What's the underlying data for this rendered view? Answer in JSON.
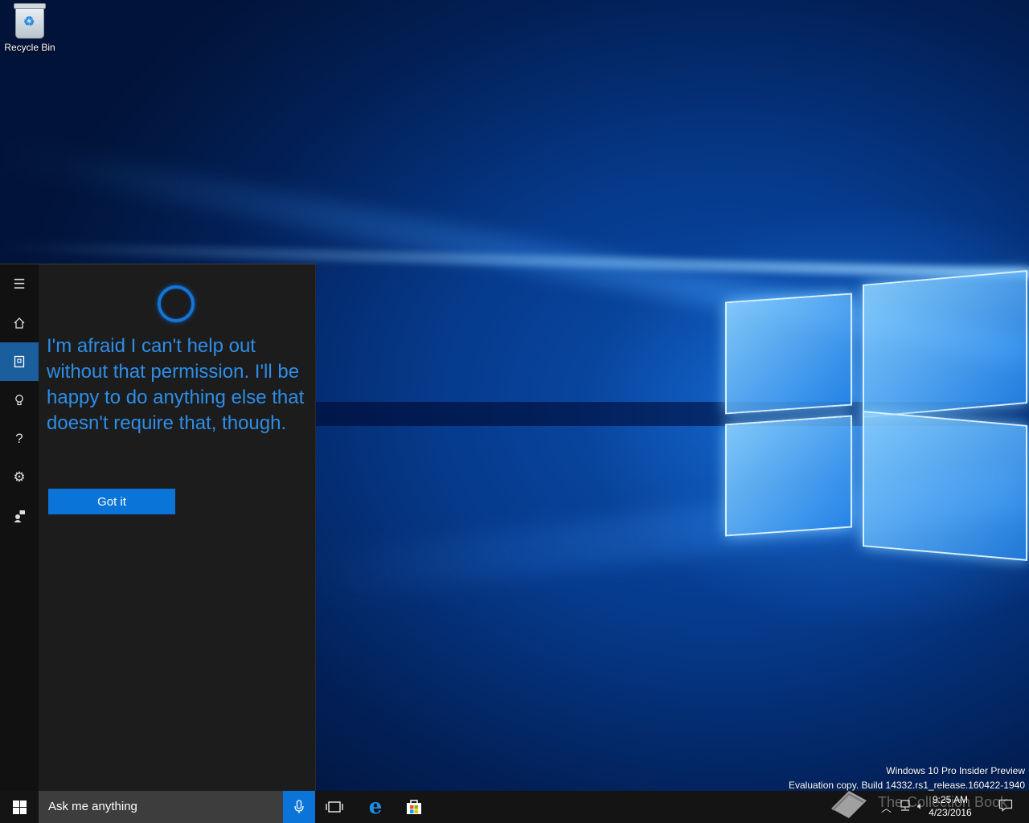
{
  "desktop": {
    "icons": [
      {
        "label": "Recycle Bin"
      }
    ],
    "watermark": {
      "line1": "Windows 10 Pro Insider Preview",
      "line2": "Evaluation copy. Build 14332.rs1_release.160422-1940"
    }
  },
  "cortana": {
    "rail": [
      {
        "name": "menu",
        "icon": "hamburger-icon"
      },
      {
        "name": "home",
        "icon": "home-icon"
      },
      {
        "name": "notebook",
        "icon": "notebook-icon",
        "active": true
      },
      {
        "name": "tips",
        "icon": "lightbulb-icon"
      },
      {
        "name": "help",
        "icon": "help-icon"
      },
      {
        "name": "settings",
        "icon": "gear-icon"
      },
      {
        "name": "feedback",
        "icon": "feedback-icon"
      }
    ],
    "message": "I'm afraid I can't help out without that permission. I'll be happy to do anything else that doesn't require that, though.",
    "button_label": "Got it",
    "accent": "#0b74d8"
  },
  "taskbar": {
    "search_placeholder": "Ask me anything",
    "pinned": [
      "task-view-icon",
      "edge-icon",
      "store-icon"
    ],
    "clock": {
      "time": "9:25 AM",
      "date": "4/23/2016"
    },
    "overlay_text": "The Collection Book"
  }
}
